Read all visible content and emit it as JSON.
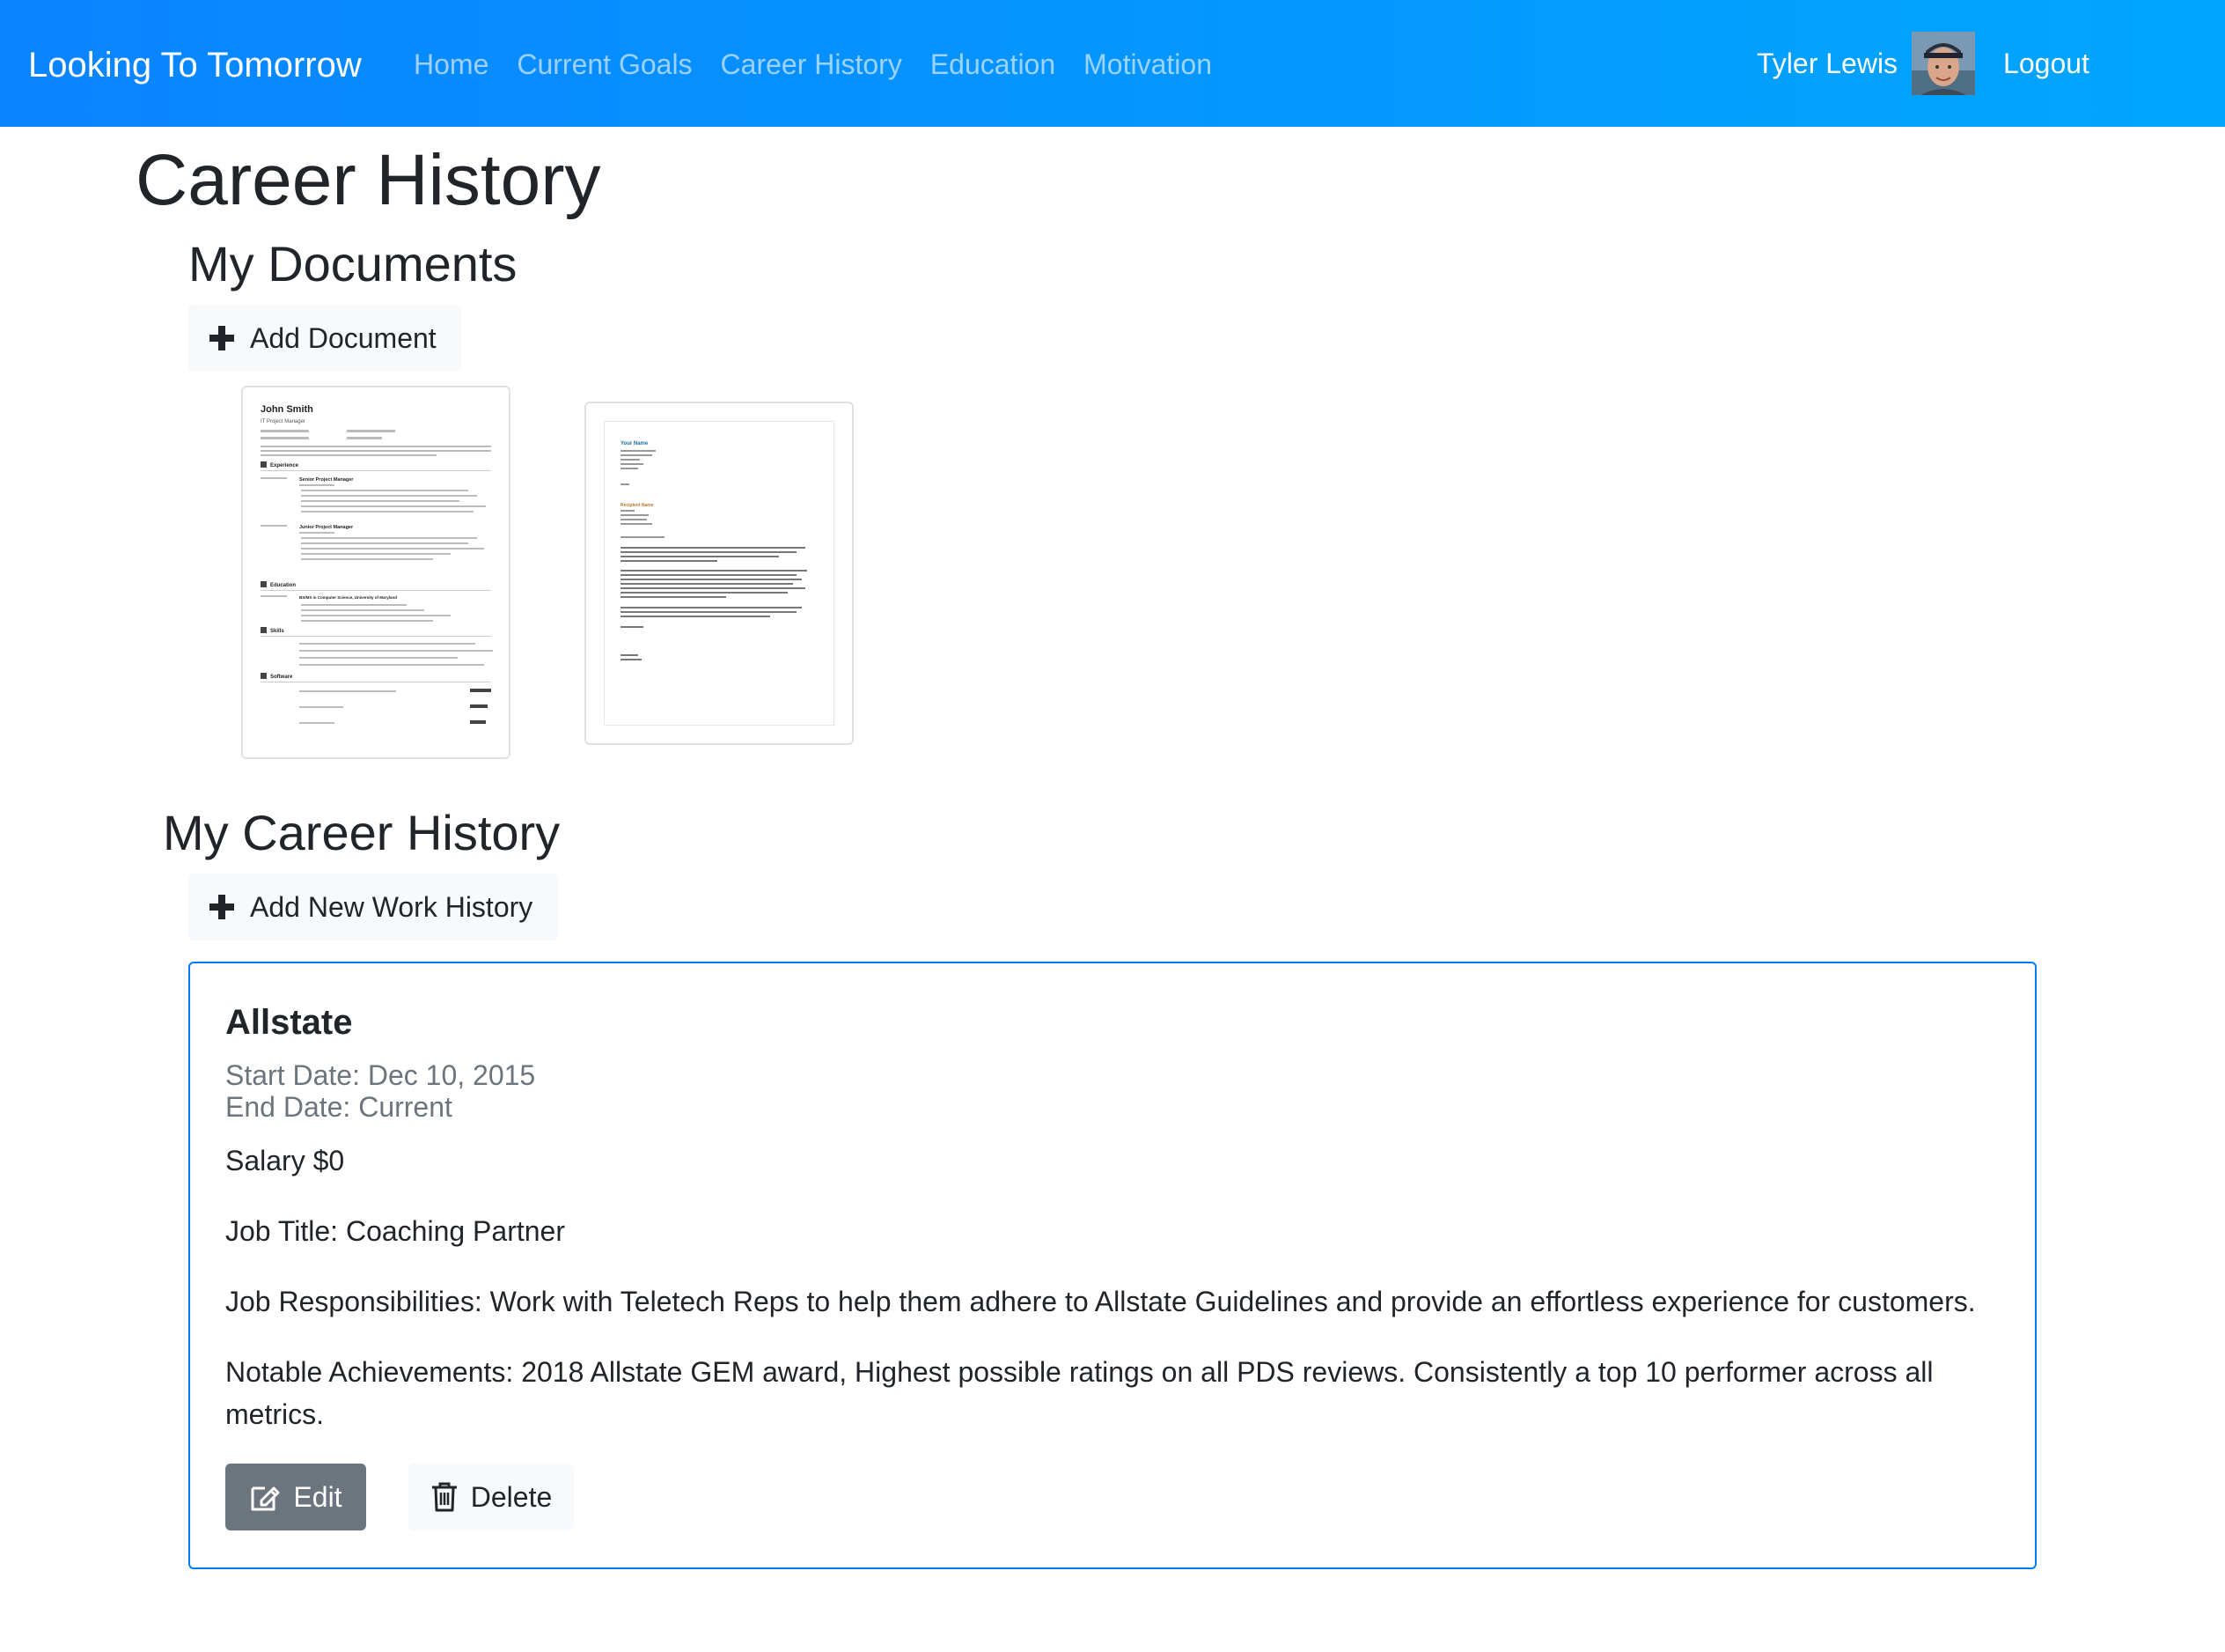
{
  "navbar": {
    "brand": "Looking To Tomorrow",
    "links": [
      "Home",
      "Current Goals",
      "Career History",
      "Education",
      "Motivation"
    ],
    "user_name": "Tyler Lewis",
    "logout": "Logout"
  },
  "page": {
    "title": "Career History"
  },
  "documents": {
    "title": "My Documents",
    "add_label": "Add Document",
    "resume": {
      "name": "John Smith",
      "role": "IT Project Manager",
      "sections": [
        "Experience",
        "Education",
        "Skills",
        "Software"
      ],
      "job_1": "Senior Project Manager",
      "job_2": "Junior Project Manager",
      "degree": "BS/MS in Computer Science, University of Maryland"
    },
    "letter": {
      "your_name": "Your Name",
      "recipient": "Recipient Name"
    }
  },
  "career": {
    "title": "My Career History",
    "add_label": "Add New Work History",
    "entry": {
      "company": "Allstate",
      "start_date": "Start Date: Dec 10, 2015",
      "end_date": "End Date: Current",
      "salary": "Salary $0",
      "job_title": "Job Title: Coaching Partner",
      "responsibilities": "Job Responsibilities: Work with Teletech Reps to help them adhere to Allstate Guidelines and provide an effortless experience for customers.",
      "achievements": "Notable Achievements: 2018 Allstate GEM award, Highest possible ratings on all PDS reviews. Consistently a top 10 performer across all metrics.",
      "edit_label": "Edit",
      "delete_label": "Delete"
    }
  },
  "icons": {
    "add": "plus-icon",
    "edit": "edit-icon",
    "delete": "trash-icon",
    "avatar": "user-avatar"
  },
  "colors": {
    "navbar_start": "#0a84ff",
    "navbar_end": "#00a6ff",
    "card_border": "#007bff",
    "edit_button": "#6c757d",
    "muted_text": "#6c757d"
  }
}
